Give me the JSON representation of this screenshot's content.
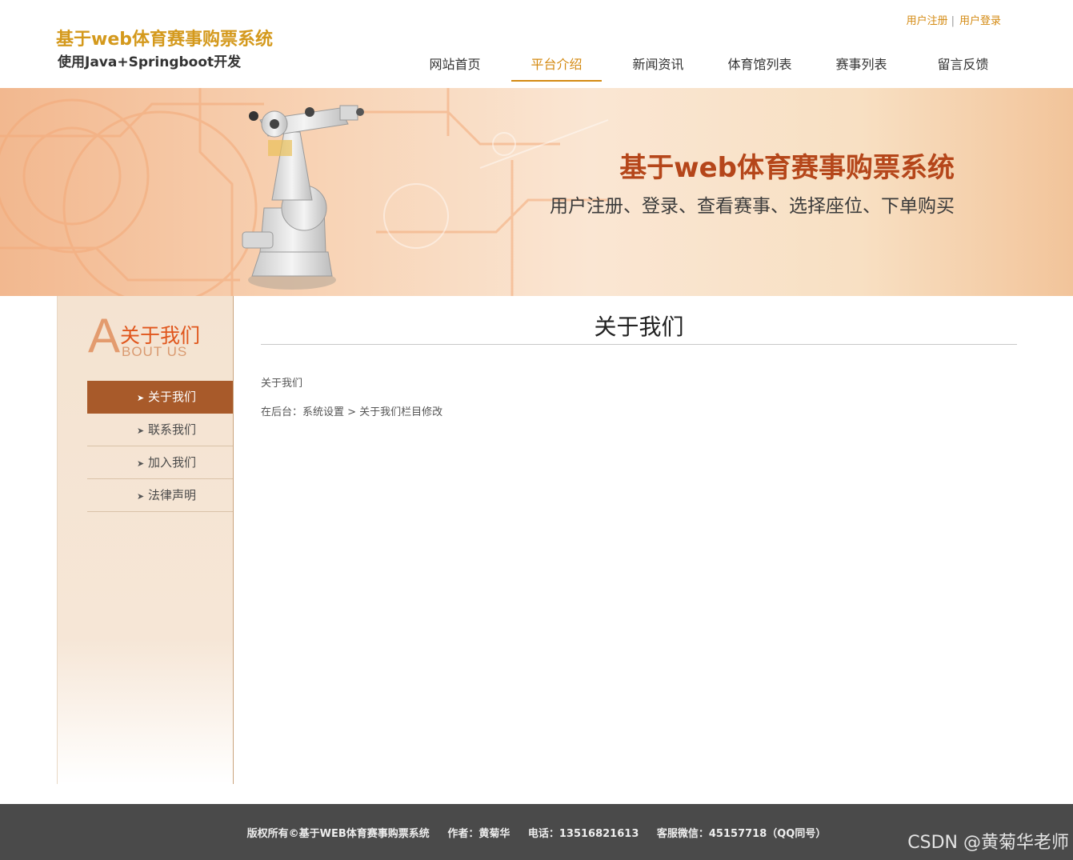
{
  "header": {
    "site_title": "基于web体育赛事购票系统",
    "site_subtitle": "使用Java+Springboot开发",
    "register_link": "用户注册",
    "login_link": "用户登录",
    "separator": "|",
    "nav": [
      {
        "label": "网站首页"
      },
      {
        "label": "平台介绍"
      },
      {
        "label": "新闻资讯"
      },
      {
        "label": "体育馆列表"
      },
      {
        "label": "赛事列表"
      },
      {
        "label": "留言反馈"
      }
    ],
    "active_nav": "平台介绍",
    "accent_color": "#d48a12"
  },
  "banner": {
    "title": "基于web体育赛事购票系统",
    "subtitle": "用户注册、登录、查看赛事、选择座位、下单购买"
  },
  "sidebar": {
    "logo_letter": "A",
    "logo_cn": "关于我们",
    "logo_en": "BOUT US",
    "items": [
      {
        "label": "关于我们"
      },
      {
        "label": "联系我们"
      },
      {
        "label": "加入我们"
      },
      {
        "label": "法律声明"
      }
    ],
    "arrow": "➤",
    "active_color": "#a85a2a"
  },
  "main": {
    "title": "关于我们",
    "line1": "关于我们",
    "line2": "在后台：系统设置 > 关于我们栏目修改"
  },
  "footer": {
    "copyright": "版权所有©基于WEB体育赛事购票系统",
    "author": "作者：黄菊华",
    "phone": "电话：13516821613",
    "wechat": "客服微信：45157718（QQ同号）"
  },
  "watermark": "CSDN @黄菊华老师"
}
